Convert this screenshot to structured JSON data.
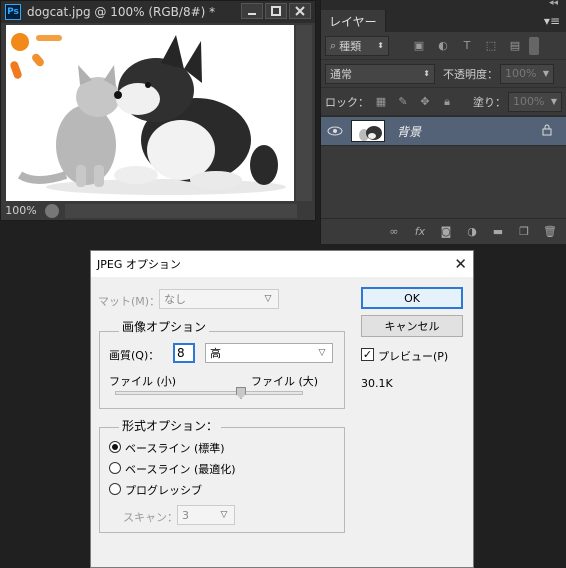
{
  "document": {
    "title": "dogcat.jpg @ 100% (RGB/8#) *",
    "ps_badge": "Ps",
    "zoom": "100%",
    "window_buttons": [
      "minimize",
      "maximize",
      "close"
    ]
  },
  "layers_panel": {
    "tab_label": "レイヤー",
    "filter_kind": "種類",
    "blend_mode": "通常",
    "opacity_label": "不透明度：",
    "opacity_value": "100%",
    "lock_label": "ロック：",
    "fill_label": "塗り：",
    "fill_value": "100%",
    "layer_name": "背景"
  },
  "dialog": {
    "title": "JPEG オプション",
    "matte_label": "マット(M)：",
    "matte_value": "なし",
    "image_options_title": "画像オプション",
    "quality_label": "画質(Q)：",
    "quality_value": "8",
    "quality_preset": "高",
    "file_small": "ファイル (小)",
    "file_large": "ファイル (大)",
    "quality_slider_fraction": 0.67,
    "format_options_title": "形式オプション：",
    "radio_baseline_standard": "ベースライン (標準)",
    "radio_baseline_optimized": "ベースライン (最適化)",
    "radio_progressive": "プログレッシブ",
    "scan_label": "スキャン：",
    "scan_value": "3",
    "ok_label": "OK",
    "cancel_label": "キャンセル",
    "preview_label": "プレビュー(P)",
    "file_size": "30.1K"
  },
  "colors": {
    "accent": "#2b78d6",
    "layer_selected": "#536277",
    "ps_blue": "#31a8ff"
  }
}
